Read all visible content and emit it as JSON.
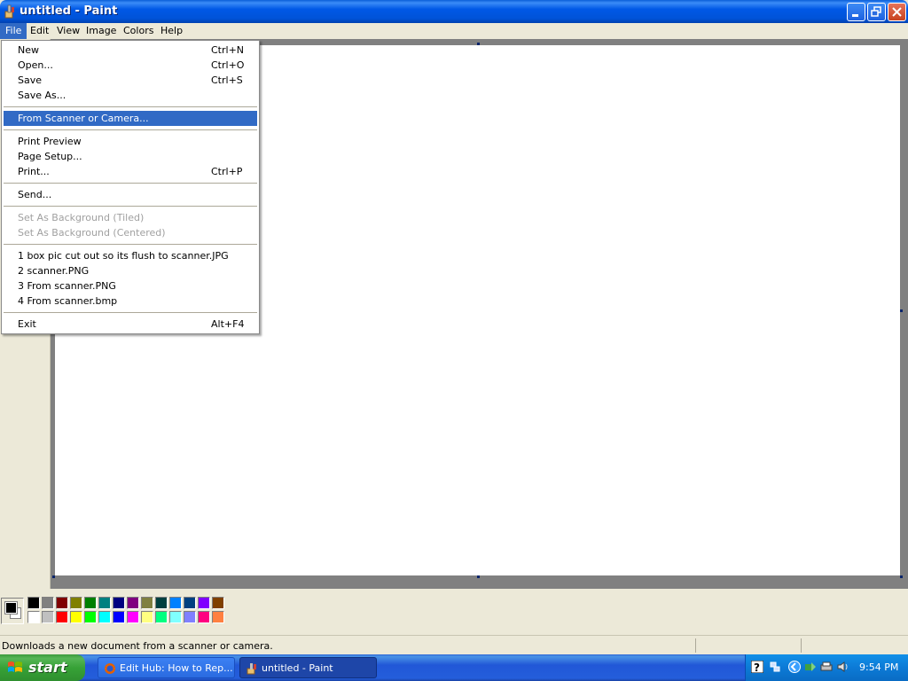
{
  "window": {
    "title": "untitled - Paint"
  },
  "menubar": {
    "items": [
      "File",
      "Edit",
      "View",
      "Image",
      "Colors",
      "Help"
    ],
    "active": "File"
  },
  "file_menu": {
    "items": [
      {
        "label": "New",
        "shortcut": "Ctrl+N"
      },
      {
        "label": "Open...",
        "shortcut": "Ctrl+O"
      },
      {
        "label": "Save",
        "shortcut": "Ctrl+S"
      },
      {
        "label": "Save As...",
        "shortcut": ""
      },
      {
        "label": "From Scanner or Camera...",
        "shortcut": "",
        "highlighted": true
      },
      {
        "label": "Print Preview",
        "shortcut": ""
      },
      {
        "label": "Page Setup...",
        "shortcut": ""
      },
      {
        "label": "Print...",
        "shortcut": "Ctrl+P"
      },
      {
        "label": "Send...",
        "shortcut": ""
      },
      {
        "label": "Set As Background (Tiled)",
        "shortcut": "",
        "disabled": true
      },
      {
        "label": "Set As Background (Centered)",
        "shortcut": "",
        "disabled": true
      },
      {
        "label": "1 box pic cut out so its flush to scanner.JPG",
        "shortcut": ""
      },
      {
        "label": "2 scanner.PNG",
        "shortcut": ""
      },
      {
        "label": "3 From scanner.PNG",
        "shortcut": ""
      },
      {
        "label": "4 From scanner.bmp",
        "shortcut": ""
      },
      {
        "label": "Exit",
        "shortcut": "Alt+F4"
      }
    ]
  },
  "palette": {
    "foreground": "#000000",
    "background": "#ffffff",
    "top_row": [
      "#000000",
      "#808080",
      "#800000",
      "#808000",
      "#008000",
      "#008080",
      "#000080",
      "#800080",
      "#808040",
      "#004040",
      "#0080ff",
      "#004080",
      "#8000ff",
      "#804000"
    ],
    "bottom_row": [
      "#ffffff",
      "#c0c0c0",
      "#ff0000",
      "#ffff00",
      "#00ff00",
      "#00ffff",
      "#0000ff",
      "#ff00ff",
      "#ffff80",
      "#00ff80",
      "#80ffff",
      "#8080ff",
      "#ff0080",
      "#ff8040"
    ]
  },
  "statusbar": {
    "text": "Downloads a new document from a scanner or camera."
  },
  "taskbar": {
    "start_label": "start",
    "tasks": [
      {
        "label": "Edit Hub: How to Rep...",
        "icon": "firefox-icon",
        "active": false
      },
      {
        "label": "untitled - Paint",
        "icon": "paint-icon",
        "active": true
      }
    ],
    "clock": "9:54 PM",
    "tray_icons": [
      "help-icon",
      "network-icon",
      "back-arrow-icon",
      "safely-remove-icon",
      "printer-icon",
      "volume-icon"
    ]
  }
}
